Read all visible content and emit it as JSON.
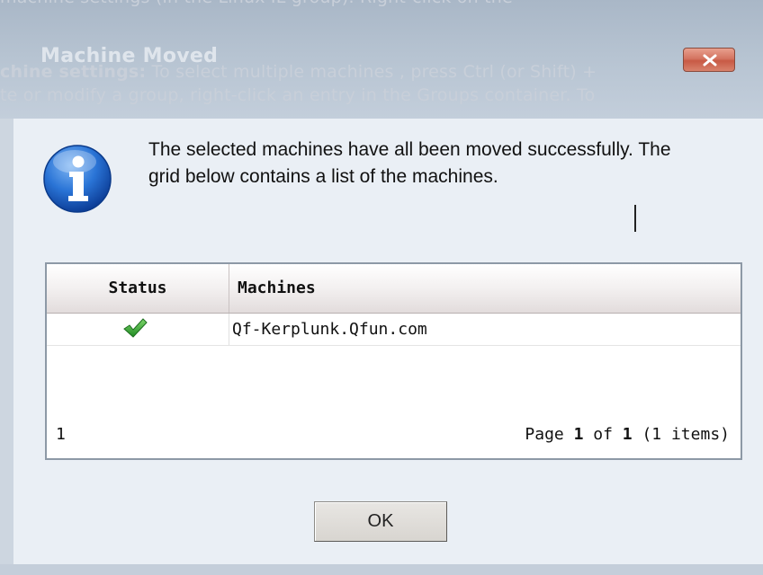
{
  "background_page": {
    "heading_fragment": "machine settings (in the Linux IL group). Right-click on the",
    "line1_bold": "chine settings:",
    "line1_rest": " To select multiple machines , press Ctrl (or Shift) +",
    "line2": "te or modify a group, right-click an entry in the Groups container. To",
    "line3": "e                                                            "
  },
  "dialog": {
    "title": "Machine Moved",
    "close_icon": "close-x-icon",
    "info_icon": "info-icon",
    "message": "The selected machines have all been moved successfully. The grid below contains a list of the machines.",
    "grid": {
      "columns": [
        "Status",
        "Machines"
      ],
      "rows": [
        {
          "status": "success-check-icon",
          "machine": "Qf-Kerplunk.Qfun.com"
        }
      ],
      "footer": {
        "count": "1",
        "page_prefix": "Page ",
        "page_current": "1",
        "page_of": " of ",
        "page_total": "1",
        "items_text": " (1 items)"
      }
    },
    "ok_label": "OK"
  },
  "colors": {
    "titlebar": "#b7c4d2",
    "content_bg": "#eaeff5",
    "close_button": "#d47461",
    "check": "#3ca83a",
    "info_icon": "#1f6fd1"
  }
}
